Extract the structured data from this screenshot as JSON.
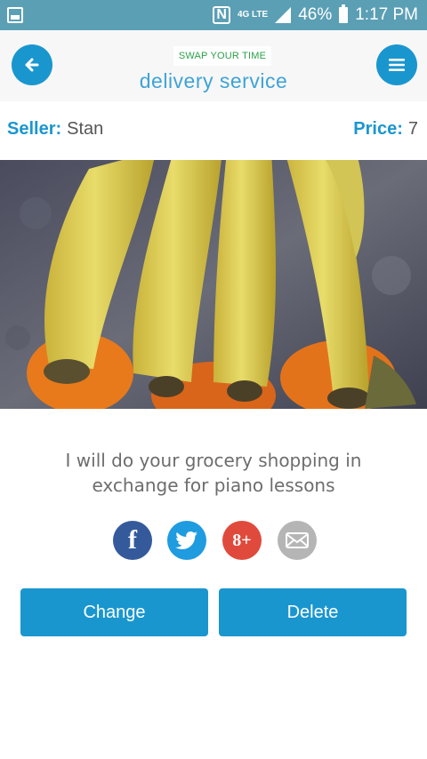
{
  "status_bar": {
    "battery_percent": "46%",
    "time": "1:17 PM",
    "network_label": "4G LTE",
    "nfc_label": "N"
  },
  "header": {
    "logo_text": "SWAP YOUR TIME",
    "subtitle": "delivery service",
    "back_icon": "arrow-left-icon",
    "menu_icon": "hamburger-menu-icon"
  },
  "listing": {
    "seller_label": "Seller:",
    "seller_name": "Stan",
    "price_label": "Price:",
    "price_value": "7",
    "description": "I will do your grocery shopping in exchange for piano lessons"
  },
  "share": {
    "facebook_glyph": "f",
    "googleplus_glyph": "8+",
    "icons": [
      "facebook-icon",
      "twitter-icon",
      "google-plus-icon",
      "email-icon"
    ]
  },
  "actions": {
    "change_label": "Change",
    "delete_label": "Delete"
  },
  "colors": {
    "accent": "#1a96cf",
    "status_bar": "#5b9fb5",
    "facebook": "#355a9c",
    "twitter": "#1f9be0",
    "google_plus": "#e04a3c",
    "email": "#b5b5b5"
  }
}
